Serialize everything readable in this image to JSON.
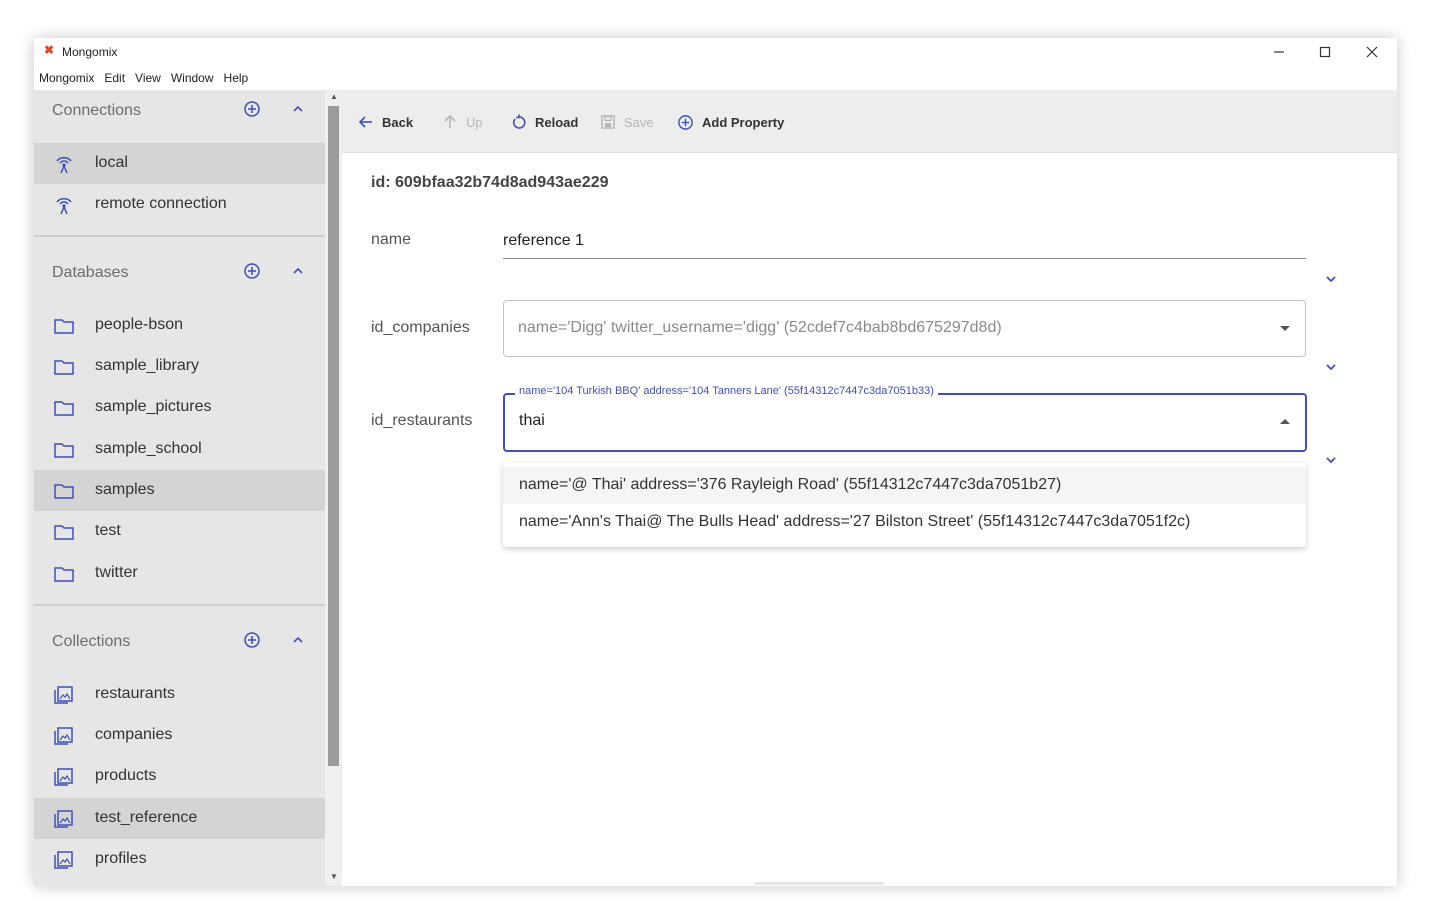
{
  "window": {
    "title": "Mongomix",
    "controls": [
      "minimize-icon",
      "maximize-icon",
      "close-icon"
    ]
  },
  "menu": [
    "Mongomix",
    "Edit",
    "View",
    "Window",
    "Help"
  ],
  "sidebar": {
    "connections": {
      "title": "Connections",
      "items": [
        {
          "label": "local",
          "selected": true
        },
        {
          "label": "remote connection",
          "selected": false
        }
      ]
    },
    "databases": {
      "title": "Databases",
      "items": [
        {
          "label": "people-bson",
          "selected": false
        },
        {
          "label": "sample_library",
          "selected": false
        },
        {
          "label": "sample_pictures",
          "selected": false
        },
        {
          "label": "sample_school",
          "selected": false
        },
        {
          "label": "samples",
          "selected": true
        },
        {
          "label": "test",
          "selected": false
        },
        {
          "label": "twitter",
          "selected": false
        }
      ]
    },
    "collections": {
      "title": "Collections",
      "items": [
        {
          "label": "restaurants",
          "selected": false
        },
        {
          "label": "companies",
          "selected": false
        },
        {
          "label": "products",
          "selected": false
        },
        {
          "label": "test_reference",
          "selected": true
        },
        {
          "label": "profiles",
          "selected": false
        }
      ]
    }
  },
  "toolbar": {
    "back": "Back",
    "up": "Up",
    "reload": "Reload",
    "save": "Save",
    "add_property": "Add Property"
  },
  "document": {
    "id_text": "id: 609bfaa32b74d8ad943ae229",
    "fields": {
      "name": {
        "label": "name",
        "value": "reference 1"
      },
      "id_companies": {
        "label": "id_companies",
        "value": "name='Digg' twitter_username='digg' (52cdef7c4bab8bd675297d8d)"
      },
      "id_restaurants": {
        "label": "id_restaurants",
        "legend": "name='104 Turkish BBQ' address='104 Tanners Lane' (55f14312c7447c3da7051b33)",
        "query": "thai",
        "options": [
          "name='@ Thai' address='376 Rayleigh Road' (55f14312c7447c3da7051b27)",
          "name='Ann's Thai@ The Bulls Head' address='27 Bilston Street' (55f14312c7447c3da7051f2c)"
        ]
      }
    }
  },
  "colors": {
    "accent": "#3f51b5",
    "sidebar_bg": "#e6e6e6",
    "selected_bg": "#d4d4d4",
    "toolbar_bg": "#ededed"
  }
}
